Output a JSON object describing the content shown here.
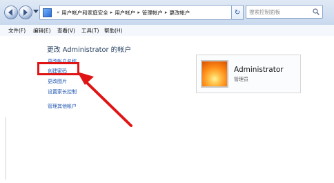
{
  "nav": {
    "breadcrumbs": [
      "用户帐户和家庭安全",
      "用户帐户",
      "管理帐户",
      "更改帐户"
    ],
    "search_placeholder": "搜索控制面板"
  },
  "menu": [
    "文件(F)",
    "编辑(E)",
    "查看(V)",
    "工具(T)",
    "帮助(H)"
  ],
  "page": {
    "title": "更改 Administrator 的帐户",
    "links": [
      "更改帐户名称",
      "创建密码",
      "更改图片",
      "设置家长控制",
      "管理其他帐户"
    ]
  },
  "account": {
    "name": "Administrator",
    "role": "管理员"
  },
  "annotation": {
    "color": "#e01414"
  }
}
